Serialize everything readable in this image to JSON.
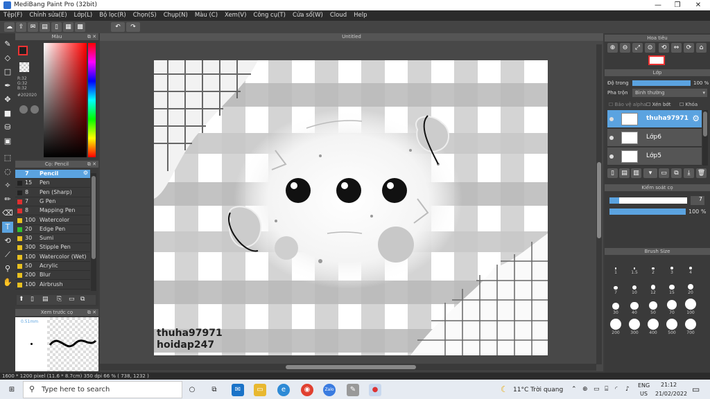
{
  "window": {
    "title": "MediBang Paint Pro (32bit)",
    "min": "—",
    "max": "❐",
    "close": "✕"
  },
  "menu": [
    "Tệp(F)",
    "Chỉnh sửa(E)",
    "Lớp(L)",
    "Bộ lọc(R)",
    "Chọn(S)",
    "Chụp(N)",
    "Màu (C)",
    "Xem(V)",
    "Công cụ(T)",
    "Cửa sổ(W)",
    "Cloud",
    "Help"
  ],
  "color_panel": {
    "title": "Màu",
    "r": "R:32",
    "g": "G:32",
    "b": "B:32",
    "hex": "#202020"
  },
  "brush_panel": {
    "title": "Cọ: Pencil",
    "items": [
      {
        "size": "7",
        "name": "Pencil",
        "color": "#5ba3e0"
      },
      {
        "size": "15",
        "name": "Pen",
        "color": "#222222"
      },
      {
        "size": "8",
        "name": "Pen (Sharp)",
        "color": "#222222"
      },
      {
        "size": "7",
        "name": "G Pen",
        "color": "#e03030"
      },
      {
        "size": "8",
        "name": "Mapping Pen",
        "color": "#e03030"
      },
      {
        "size": "100",
        "name": "Watercolor",
        "color": "#e8c020"
      },
      {
        "size": "20",
        "name": "Edge Pen",
        "color": "#30c030"
      },
      {
        "size": "30",
        "name": "Sumi",
        "color": "#e8c020"
      },
      {
        "size": "300",
        "name": "Stipple Pen",
        "color": "#e8c020"
      },
      {
        "size": "100",
        "name": "Watercolor (Wet)",
        "color": "#e8c020"
      },
      {
        "size": "50",
        "name": "Acrylic",
        "color": "#e8c020"
      },
      {
        "size": "200",
        "name": "Blur",
        "color": "#e8c020"
      },
      {
        "size": "100",
        "name": "Airbrush",
        "color": "#e8c020"
      }
    ]
  },
  "preview_panel": {
    "title": "Xem trước cọ",
    "size": "0.51mm"
  },
  "document": {
    "title": "Untitled"
  },
  "canvas_text": {
    "line1": "thuha97971",
    "line2": "hoidap247"
  },
  "navigator": {
    "title": "Hoa tiêu"
  },
  "layer_panel": {
    "title": "Lớp",
    "opacity_label": "Độ trong",
    "opacity_value": "100 %",
    "blend_label": "Pha trộn",
    "blend_value": "Bình thường",
    "protect_alpha": "Bảo vệ alpha",
    "clipping": "Xén bớt",
    "lock": "Khóa",
    "layers": [
      {
        "name": "thuha97971",
        "selected": true
      },
      {
        "name": "Lớp6",
        "selected": false
      },
      {
        "name": "Lớp5",
        "selected": false
      }
    ]
  },
  "brush_control": {
    "title": "Kiểm soát cọ",
    "size": "7",
    "opacity": "100 %"
  },
  "brush_size_panel": {
    "title": "Brush Size",
    "sizes": [
      "1",
      "1.5",
      "2",
      "3",
      "4",
      "7",
      "10",
      "12",
      "15",
      "20",
      "30",
      "40",
      "50",
      "70",
      "100",
      "200",
      "300",
      "400",
      "500",
      "700"
    ]
  },
  "status": {
    "text": "1600 * 1200 pixel   (11.6 * 8.7cm)   350 dpi   66 %   ( 738, 1232 )"
  },
  "taskbar": {
    "search_placeholder": "Type here to search",
    "weather": "11°C  Trời quang",
    "lang1": "ENG",
    "lang2": "US",
    "time": "21:12",
    "date": "21/02/2022"
  }
}
